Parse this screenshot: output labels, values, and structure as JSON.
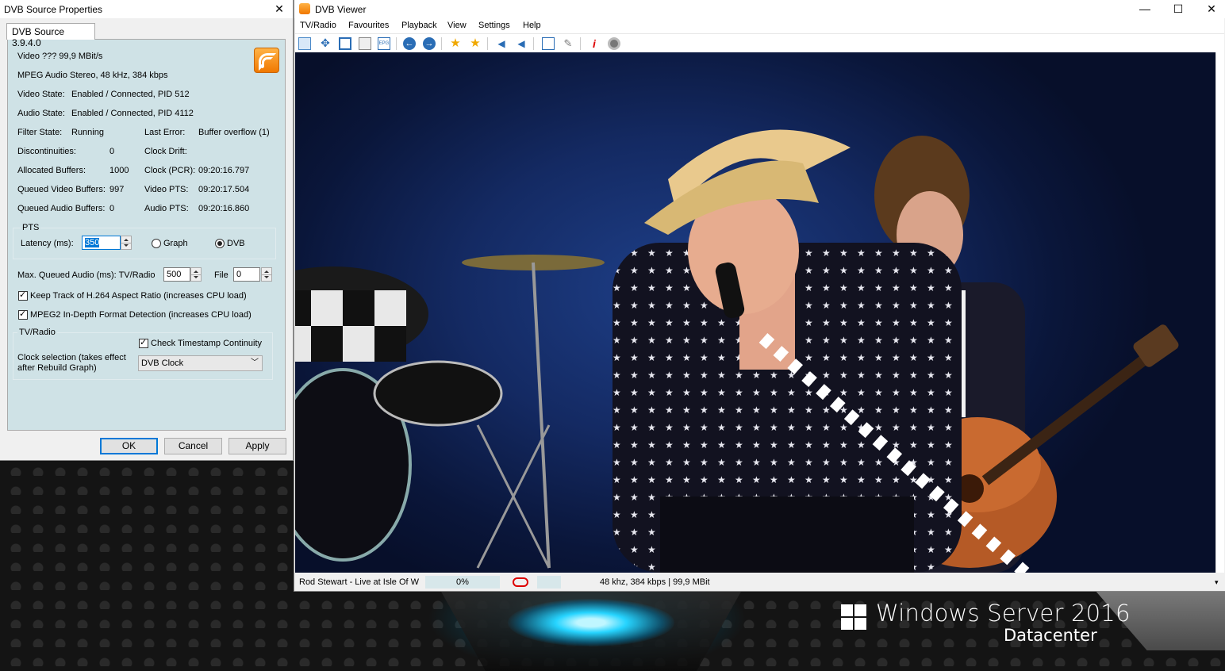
{
  "desktop": {
    "brand_title": "Windows Server 2016",
    "brand_edition": "Datacenter"
  },
  "props": {
    "title": "DVB Source Properties",
    "close_glyph": "✕",
    "tab_label": "DVB Source 3.9.4.0",
    "rss_icon": "rss-feed-icon",
    "video_line": "Video  ???   99,9 MBit/s",
    "audio_line": "MPEG Audio Stereo, 48 kHz, 384 kbps",
    "video_state_label": "Video State:",
    "video_state_value": "Enabled / Connected, PID 512",
    "audio_state_label": "Audio State:",
    "audio_state_value": "Enabled / Connected, PID 4112",
    "stats_left": [
      {
        "label": "Filter State:",
        "value": "Running"
      },
      {
        "label": "Discontinuities:",
        "value": "0"
      },
      {
        "label": "Allocated Buffers:",
        "value": "1000"
      },
      {
        "label": "Queued Video Buffers:",
        "value": "997"
      },
      {
        "label": "Queued Audio Buffers:",
        "value": "0"
      }
    ],
    "stats_right": [
      {
        "label": "Last Error:",
        "value": "Buffer overflow (1)"
      },
      {
        "label": "Clock Drift:",
        "value": ""
      },
      {
        "label": "Clock (PCR):",
        "value": "09:20:16.797"
      },
      {
        "label": "Video PTS:",
        "value": "09:20:17.504"
      },
      {
        "label": "Audio PTS:",
        "value": "09:20:16.860"
      }
    ],
    "pts_group_label": "PTS",
    "latency_label": "Latency (ms):",
    "latency_value": "350",
    "radio_graph": "Graph",
    "radio_dvb": "DVB",
    "max_queued_label": "Max. Queued Audio (ms): TV/Radio",
    "max_queued_value": "500",
    "file_label": "File",
    "file_value": "0",
    "keep_track_label": "Keep Track of H.264 Aspect Ratio (increases CPU load)",
    "mpeg2_label": "MPEG2 In-Depth Format Detection (increases CPU load)",
    "tvradio_group_label": "TV/Radio",
    "check_timestamp_label": "Check Timestamp Continuity",
    "clock_selection_label_1": "Clock selection (takes effect",
    "clock_selection_label_2": "after Rebuild Graph)",
    "clock_selection_value": "DVB Clock",
    "ok": "OK",
    "cancel": "Cancel",
    "apply": "Apply"
  },
  "viewer": {
    "title": "DVB Viewer",
    "min_glyph": "—",
    "max_glyph": "☐",
    "close_glyph": "✕",
    "menu": [
      "TV/Radio",
      "Favourites",
      "Playback",
      "View",
      "Settings",
      "Help"
    ],
    "toolbar_icons": [
      "window-mode-icon",
      "fullscreen-icon",
      "desktop-mode-icon",
      "osd-icon",
      "epg-icon",
      "back-icon",
      "forward-icon",
      "favourite-icon",
      "favourite-add-icon",
      "volume-down-icon",
      "volume-up-icon",
      "screenshot-icon",
      "settings-wrench-icon",
      "info-icon",
      "record-icon"
    ],
    "epg_label": "EPG",
    "status_channel": "Rod Stewart - Live at Isle Of W",
    "status_progress": "0%",
    "status_audio": "48 khz, 384 kbps | 99,9 MBit",
    "accent": "#0078d7"
  }
}
